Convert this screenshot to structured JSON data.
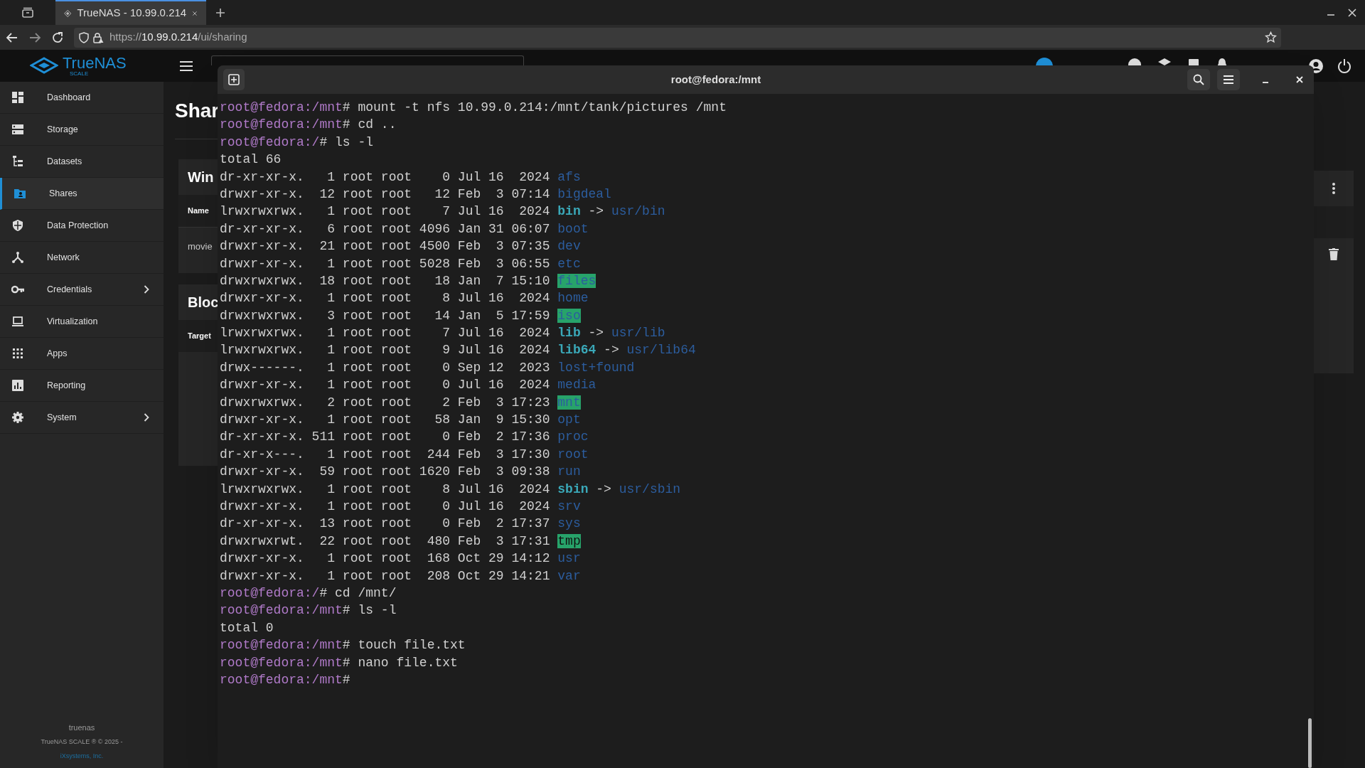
{
  "browser": {
    "tab": {
      "title": "TrueNAS - 10.99.0.214",
      "selected": true
    },
    "url": {
      "scheme": "https://",
      "host": "10.99.0.214",
      "path": "/ui/sharing"
    }
  },
  "app": {
    "brand": "TrueNAS",
    "brand_sub": "SCALE"
  },
  "sidebar": {
    "items": [
      {
        "label": "Dashboard",
        "selected": false,
        "has_submenu": false
      },
      {
        "label": "Storage",
        "selected": false,
        "has_submenu": false
      },
      {
        "label": "Datasets",
        "selected": false,
        "has_submenu": false
      },
      {
        "label": "Shares",
        "selected": true,
        "has_submenu": false
      },
      {
        "label": "Data Protection",
        "selected": false,
        "has_submenu": false
      },
      {
        "label": "Network",
        "selected": false,
        "has_submenu": false
      },
      {
        "label": "Credentials",
        "selected": false,
        "has_submenu": true
      },
      {
        "label": "Virtualization",
        "selected": false,
        "has_submenu": false
      },
      {
        "label": "Apps",
        "selected": false,
        "has_submenu": false
      },
      {
        "label": "Reporting",
        "selected": false,
        "has_submenu": false
      },
      {
        "label": "System",
        "selected": false,
        "has_submenu": true
      }
    ],
    "footer": {
      "hostname": "truenas",
      "copyright": "TrueNAS SCALE ® © 2025 -",
      "company": "iXsystems, Inc."
    }
  },
  "page": {
    "title": "Shar",
    "cards": [
      {
        "title": "Win",
        "column": "Name",
        "rows": [
          "movie"
        ]
      },
      {
        "title": "Bloc",
        "column": "Target"
      }
    ]
  },
  "terminal": {
    "title": "root@fedora:/mnt",
    "lines": [
      {
        "kind": "prompt",
        "prompt": "root@fedora:/mnt",
        "sign": "#",
        "command": "mount -t nfs 10.99.0.214:/mnt/tank/pictures /mnt"
      },
      {
        "kind": "prompt",
        "prompt": "root@fedora:/mnt",
        "sign": "#",
        "command": "cd .."
      },
      {
        "kind": "prompt",
        "prompt": "root@fedora:/",
        "sign": "#",
        "command": "ls -l"
      },
      {
        "kind": "output",
        "text": "total 66"
      },
      {
        "kind": "dir",
        "meta": "dr-xr-xr-x.   1 root root    0 Jul 16  2024",
        "name": "afs"
      },
      {
        "kind": "dir",
        "meta": "drwxr-xr-x.  12 root root   12 Feb  3 07:14",
        "name": "bigdeal"
      },
      {
        "kind": "link",
        "meta": "lrwxrwxrwx.   1 root root    7 Jul 16  2024",
        "name": "bin",
        "arrow": "->",
        "target": "usr/bin"
      },
      {
        "kind": "dir",
        "meta": "dr-xr-xr-x.   6 root root 4096 Jan 31 06:07",
        "name": "boot"
      },
      {
        "kind": "dir",
        "meta": "drwxr-xr-x.  21 root root 4500 Feb  3 07:35",
        "name": "dev"
      },
      {
        "kind": "dir",
        "meta": "drwxr-xr-x.   1 root root 5028 Feb  3 06:55",
        "name": "etc"
      },
      {
        "kind": "writable_dir",
        "meta": "drwxrwxrwx.  18 root root   18 Jan  7 15:10",
        "name": "files"
      },
      {
        "kind": "dir",
        "meta": "drwxr-xr-x.   1 root root    8 Jul 16  2024",
        "name": "home"
      },
      {
        "kind": "writable_dir",
        "meta": "drwxrwxrwx.   3 root root   14 Jan  5 17:59",
        "name": "iso"
      },
      {
        "kind": "link",
        "meta": "lrwxrwxrwx.   1 root root    7 Jul 16  2024",
        "name": "lib",
        "arrow": "->",
        "target": "usr/lib"
      },
      {
        "kind": "link",
        "meta": "lrwxrwxrwx.   1 root root    9 Jul 16  2024",
        "name": "lib64",
        "arrow": "->",
        "target": "usr/lib64"
      },
      {
        "kind": "dir",
        "meta": "drwx------.   1 root root    0 Sep 12  2023",
        "name": "lost+found"
      },
      {
        "kind": "dir",
        "meta": "drwxr-xr-x.   1 root root    0 Jul 16  2024",
        "name": "media"
      },
      {
        "kind": "writable_dir",
        "meta": "drwxrwxrwx.   2 root root    2 Feb  3 17:23",
        "name": "mnt"
      },
      {
        "kind": "dir",
        "meta": "drwxr-xr-x.   1 root root   58 Jan  9 15:30",
        "name": "opt"
      },
      {
        "kind": "dir",
        "meta": "dr-xr-xr-x. 511 root root    0 Feb  2 17:36",
        "name": "proc"
      },
      {
        "kind": "dir",
        "meta": "dr-xr-x---.   1 root root  244 Feb  3 17:30",
        "name": "root"
      },
      {
        "kind": "dir",
        "meta": "drwxr-xr-x.  59 root root 1620 Feb  3 09:38",
        "name": "run"
      },
      {
        "kind": "link",
        "meta": "lrwxrwxrwx.   1 root root    8 Jul 16  2024",
        "name": "sbin",
        "arrow": "->",
        "target": "usr/sbin"
      },
      {
        "kind": "dir",
        "meta": "drwxr-xr-x.   1 root root    0 Jul 16  2024",
        "name": "srv"
      },
      {
        "kind": "dir",
        "meta": "dr-xr-xr-x.  13 root root    0 Feb  2 17:37",
        "name": "sys"
      },
      {
        "kind": "sticky_dir",
        "meta": "drwxrwxrwt.  22 root root  480 Feb  3 17:31",
        "name": "tmp"
      },
      {
        "kind": "dir",
        "meta": "drwxr-xr-x.   1 root root  168 Oct 29 14:12",
        "name": "usr"
      },
      {
        "kind": "dir",
        "meta": "drwxr-xr-x.   1 root root  208 Oct 29 14:21",
        "name": "var"
      },
      {
        "kind": "prompt",
        "prompt": "root@fedora:/",
        "sign": "#",
        "command": "cd /mnt/"
      },
      {
        "kind": "prompt",
        "prompt": "root@fedora:/mnt",
        "sign": "#",
        "command": "ls -l"
      },
      {
        "kind": "output",
        "text": "total 0"
      },
      {
        "kind": "prompt",
        "prompt": "root@fedora:/mnt",
        "sign": "#",
        "command": "touch file.txt"
      },
      {
        "kind": "prompt",
        "prompt": "root@fedora:/mnt",
        "sign": "#",
        "command": "nano file.txt"
      },
      {
        "kind": "prompt",
        "prompt": "root@fedora:/mnt",
        "sign": "#"
      }
    ]
  }
}
